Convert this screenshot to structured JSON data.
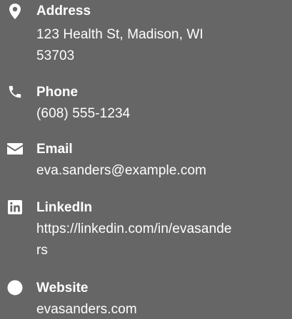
{
  "contacts": {
    "address": {
      "label": "Address",
      "line1": "123 Health St, Madison, WI",
      "line2": "53703",
      "icon": "map-pin-icon"
    },
    "phone": {
      "label": "Phone",
      "line1": "(608) 555-1234",
      "icon": "phone-icon"
    },
    "email": {
      "label": "Email",
      "line1": "eva.sanders@example.com",
      "icon": "envelope-icon"
    },
    "linkedin": {
      "label": "LinkedIn",
      "line1": "https://linkedin.com/in/evasande",
      "line2": "rs",
      "icon": "linkedin-icon"
    },
    "website": {
      "label": "Website",
      "line1": "evasanders.com",
      "icon": "globe-icon"
    }
  }
}
